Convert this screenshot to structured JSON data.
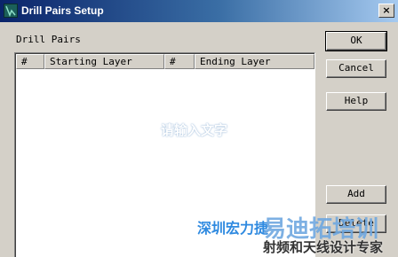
{
  "window": {
    "title": "Drill Pairs Setup",
    "close_label": "×",
    "app_icon": "app-icon"
  },
  "drill_pairs": {
    "group_label": "Drill Pairs",
    "columns": [
      "#",
      "Starting Layer",
      "#",
      "Ending Layer"
    ],
    "rows": []
  },
  "buttons": {
    "ok": "OK",
    "cancel": "Cancel",
    "help": "Help",
    "add": "Add",
    "delete": "Delete"
  },
  "watermarks": {
    "placeholder": "请输入文字",
    "company": "深圳宏力捷",
    "brand": "易迪拓培训",
    "tagline": "射频和天线设计专家"
  }
}
